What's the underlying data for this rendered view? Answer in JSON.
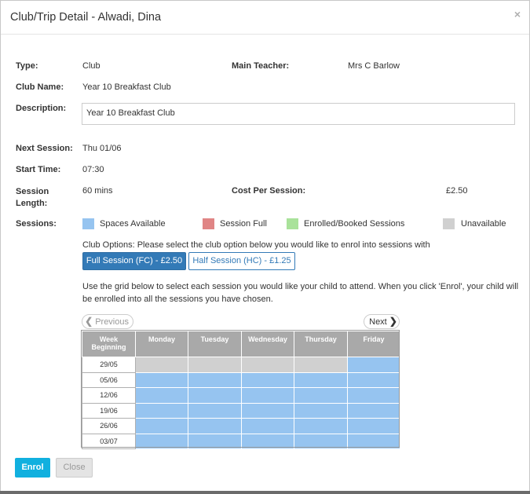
{
  "header": {
    "title": "Club/Trip Detail - Alwadi, Dina",
    "close": "×"
  },
  "details": {
    "type_label": "Type:",
    "type_value": "Club",
    "main_teacher_label": "Main Teacher:",
    "main_teacher_value": "Mrs C Barlow",
    "club_name_label": "Club Name:",
    "club_name_value": "Year 10 Breakfast Club",
    "description_label": "Description:",
    "description_value": "Year 10 Breakfast Club",
    "next_session_label": "Next Session:",
    "next_session_value": "Thu 01/06",
    "start_time_label": "Start Time:",
    "start_time_value": "07:30",
    "session_length_label_1": "Session",
    "session_length_label_2": "Length:",
    "session_length_value": "60 mins",
    "cost_label": "Cost Per Session:",
    "cost_value": "£2.50",
    "sessions_label": "Sessions:"
  },
  "legend": [
    {
      "label": "Spaces Available",
      "color": "#96c4f0"
    },
    {
      "label": "Session Full",
      "color": "#e08585"
    },
    {
      "label": "Enrolled/Booked Sessions",
      "color": "#a9e29a"
    },
    {
      "label": "Unavailable",
      "color": "#d0d0d0"
    }
  ],
  "options": {
    "prompt": "Club Options: Please select the club option below you would like to enrol into sessions with",
    "full_label": "Full Session (FC) - £2.50",
    "half_label": "Half Session (HC) - £1.25"
  },
  "instructions": "Use the grid below to select each session you would like your child to attend. When you click 'Enrol', your child will be enrolled into all the sessions you have chosen.",
  "nav": {
    "previous": "Previous",
    "next": "Next"
  },
  "grid": {
    "week_header_1": "Week",
    "week_header_2": "Beginning",
    "days": [
      "Monday",
      "Tuesday",
      "Wednesday",
      "Thursday",
      "Friday"
    ],
    "rows": [
      {
        "week": "29/05",
        "cells": [
          "unavailable",
          "unavailable",
          "unavailable",
          "unavailable",
          "available"
        ]
      },
      {
        "week": "05/06",
        "cells": [
          "available",
          "available",
          "available",
          "available",
          "available"
        ]
      },
      {
        "week": "12/06",
        "cells": [
          "available",
          "available",
          "available",
          "available",
          "available"
        ]
      },
      {
        "week": "19/06",
        "cells": [
          "available",
          "available",
          "available",
          "available",
          "available"
        ]
      },
      {
        "week": "26/06",
        "cells": [
          "available",
          "available",
          "available",
          "available",
          "available"
        ]
      },
      {
        "week": "03/07",
        "cells": [
          "available",
          "available",
          "available",
          "available",
          "available"
        ]
      }
    ]
  },
  "footer": {
    "enrol_label": "Enrol",
    "close_label": "Close"
  }
}
